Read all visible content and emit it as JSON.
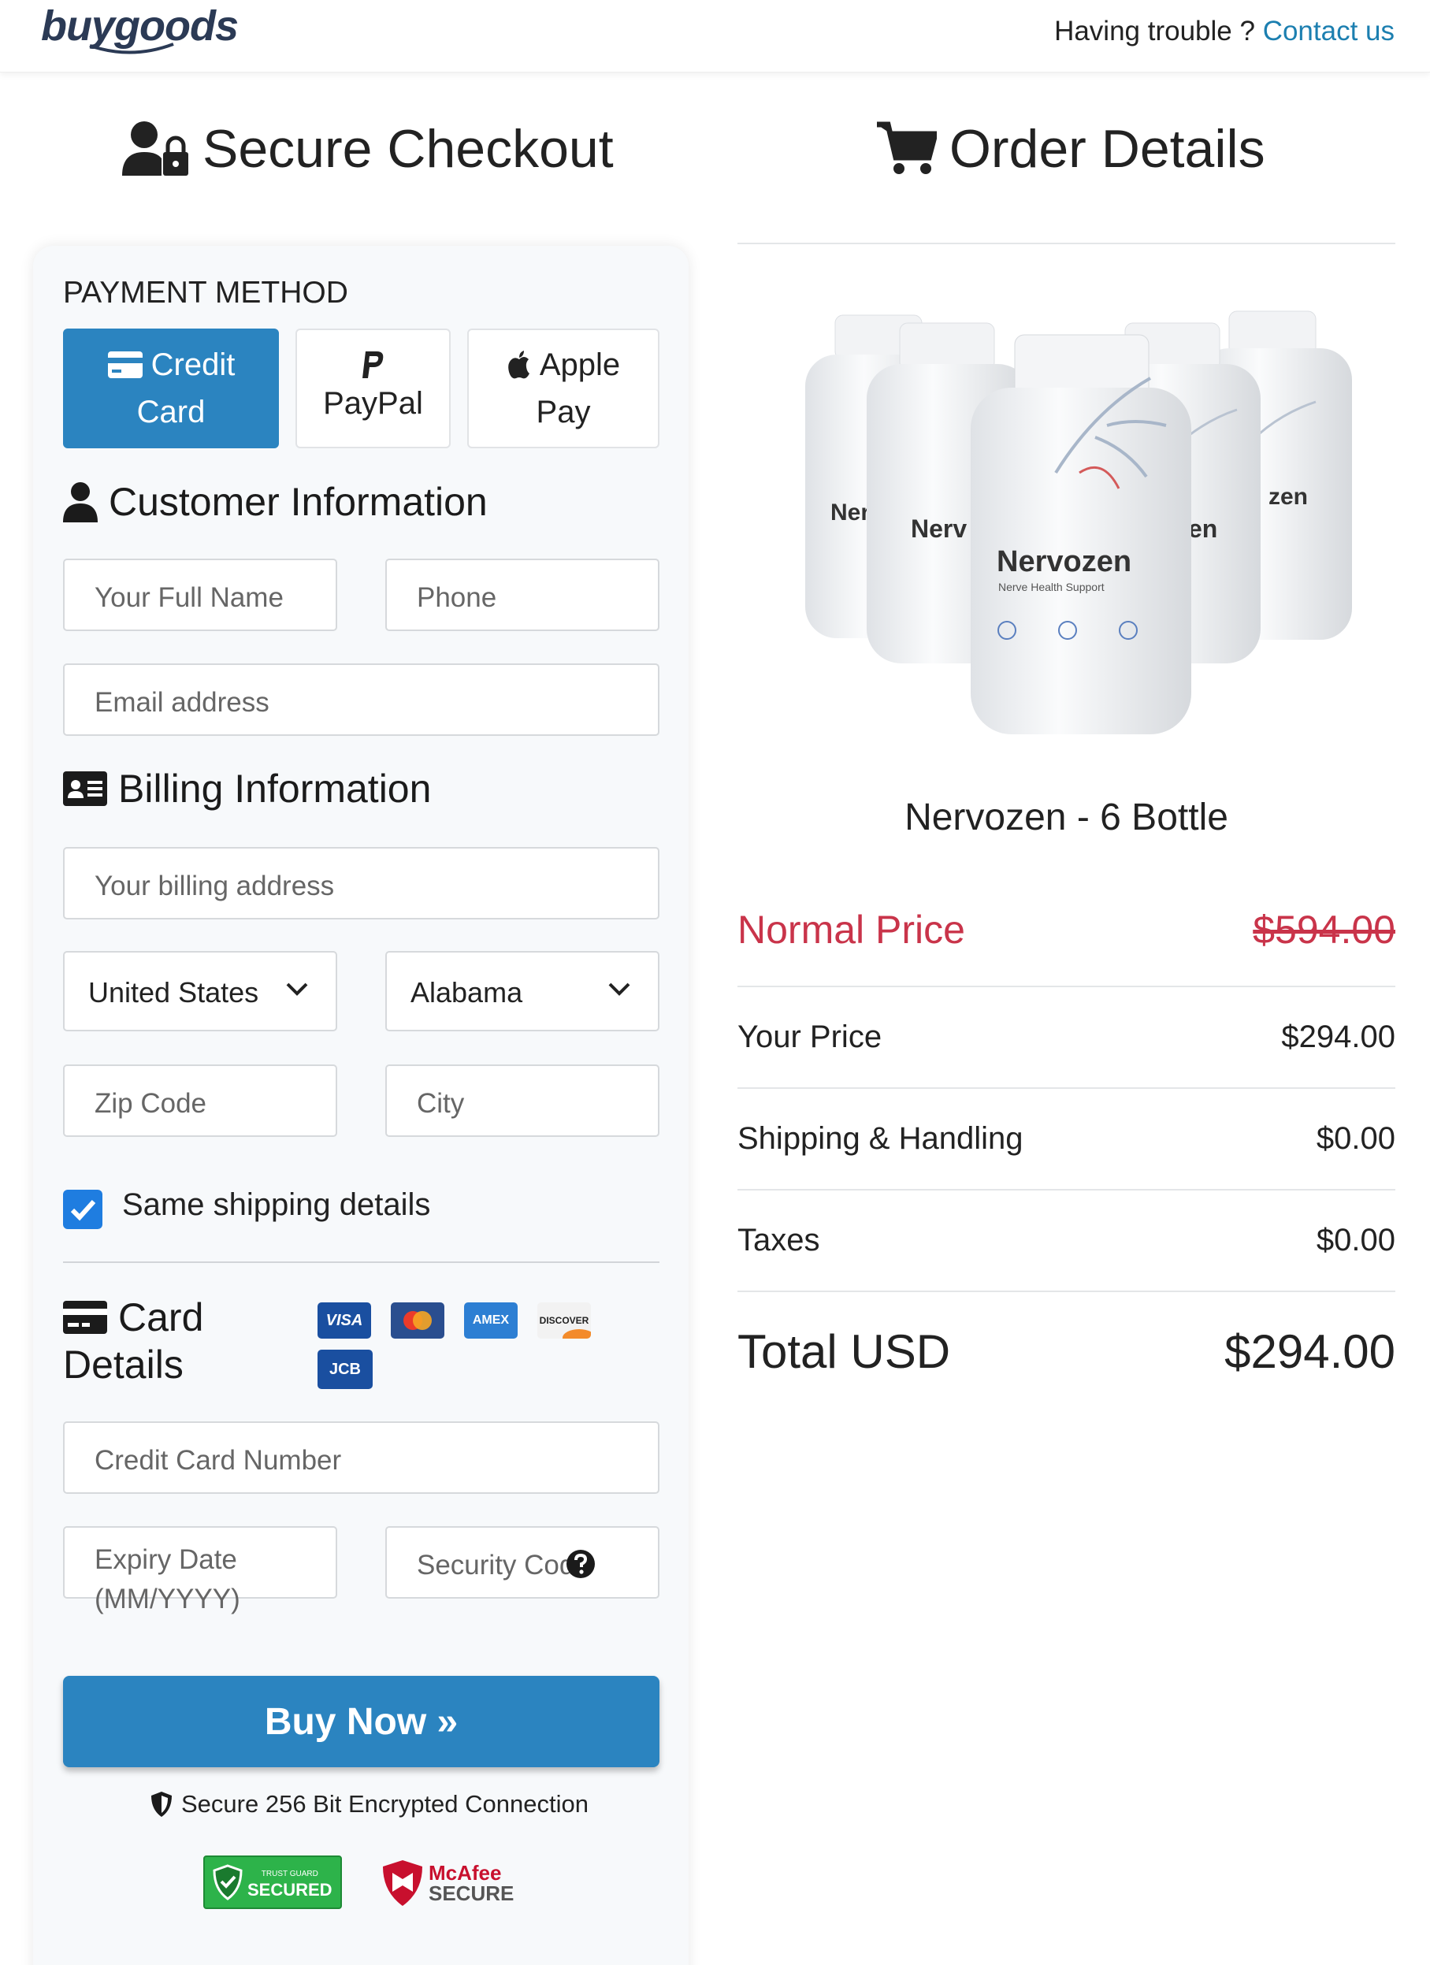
{
  "header": {
    "logo": "buygoods",
    "help_text": "Having trouble ?",
    "contact_link": "Contact us"
  },
  "checkout": {
    "title": "Secure Checkout",
    "payment_method_label": "PAYMENT METHOD",
    "payment_options": [
      {
        "line1": "Credit",
        "line2": "Card",
        "icon": "credit-card-icon",
        "selected": true
      },
      {
        "line1": "PayPal",
        "line2": "",
        "icon": "paypal-icon",
        "selected": false
      },
      {
        "line1": "Apple",
        "line2": "Pay",
        "icon": "apple-icon",
        "selected": false
      }
    ],
    "customer_info_title": "Customer Information",
    "full_name_placeholder": "Your Full Name",
    "phone_placeholder": "Phone",
    "email_placeholder": "Email address",
    "billing_info_title": "Billing Information",
    "billing_address_placeholder": "Your billing address",
    "country_selected": "United States",
    "state_selected": "Alabama",
    "zip_placeholder": "Zip Code",
    "city_placeholder": "City",
    "same_shipping_label": "Same shipping details",
    "same_shipping_checked": true,
    "card_details_title_line1": "Card",
    "card_details_title_line2": "Details",
    "card_brands": [
      "VISA",
      "mastercard",
      "AMEX",
      "DISCOVER",
      "JCB"
    ],
    "card_number_placeholder": "Credit Card Number",
    "expiry_placeholder_line1": "Expiry Date",
    "expiry_placeholder_line2": "(MM/YYYY)",
    "security_code_placeholder": "Security Code",
    "buy_button": "Buy Now »",
    "secure_connection": "Secure 256 Bit Encrypted Connection",
    "badges": {
      "trustguard_small": "TRUST GUARD",
      "trustguard_main": "SECURED",
      "mcafee_top": "McAfee",
      "mcafee_bottom": "SECURE"
    }
  },
  "order": {
    "title": "Order Details",
    "bottle_labels": [
      "Nerv",
      "Nerv",
      "Nervozen",
      "zen",
      "zen"
    ],
    "bottle_sublabel": "Nerve Health Support",
    "product_name": "Nervozen - 6 Bottle",
    "normal_price_label": "Normal Price",
    "normal_price": "$594.00",
    "your_price_label": "Your Price",
    "your_price": "$294.00",
    "shipping_label": "Shipping & Handling",
    "shipping": "$0.00",
    "taxes_label": "Taxes",
    "taxes": "$0.00",
    "total_label": "Total USD",
    "total": "$294.00"
  },
  "colors": {
    "primary": "#2b84c0",
    "link": "#1c7fb0",
    "normal_price": "#c9344a",
    "checkbox": "#1f7de0"
  }
}
